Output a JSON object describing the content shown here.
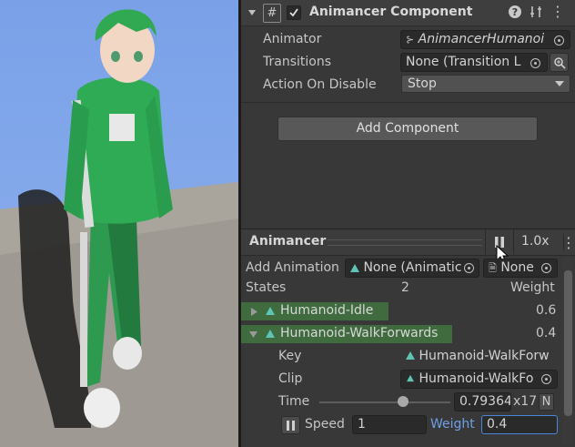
{
  "component": {
    "title": "Animancer Component",
    "fields": [
      {
        "label": "Animator",
        "value": "AnimancerHumanoi"
      },
      {
        "label": "Transitions",
        "value": "None (Transition L"
      },
      {
        "label": "Action On Disable",
        "value": "Stop"
      }
    ],
    "add_component": "Add Component"
  },
  "animancer": {
    "title": "Animancer",
    "speed_display": "1.0x",
    "add_animation_label": "Add Animation",
    "add_animation_value": "None (Animatic",
    "add_animation_value2": "None",
    "states_label": "States",
    "states_count": "2",
    "weight_header": "Weight",
    "states": [
      {
        "name": "Humanoid-Idle",
        "weight": "0.6"
      },
      {
        "name": "Humanoid-WalkForwards",
        "weight": "0.4"
      }
    ],
    "detail": {
      "key_label": "Key",
      "key_value": "Humanoid-WalkForw",
      "clip_label": "Clip",
      "clip_value": "Humanoid-WalkFo",
      "time_label": "Time",
      "time_value": "0.79364",
      "time_suffix": "x17",
      "time_n": "N",
      "time_fraction": 0.64,
      "speed_label": "Speed",
      "speed_value": "1",
      "weight_label": "Weight",
      "weight_value": "0.4"
    }
  },
  "colors": {
    "inspector_bg": "#383838",
    "highlight_green": "#3f6b3f",
    "accent_blue": "#4b86d8",
    "sky": "#7aa1e8"
  }
}
